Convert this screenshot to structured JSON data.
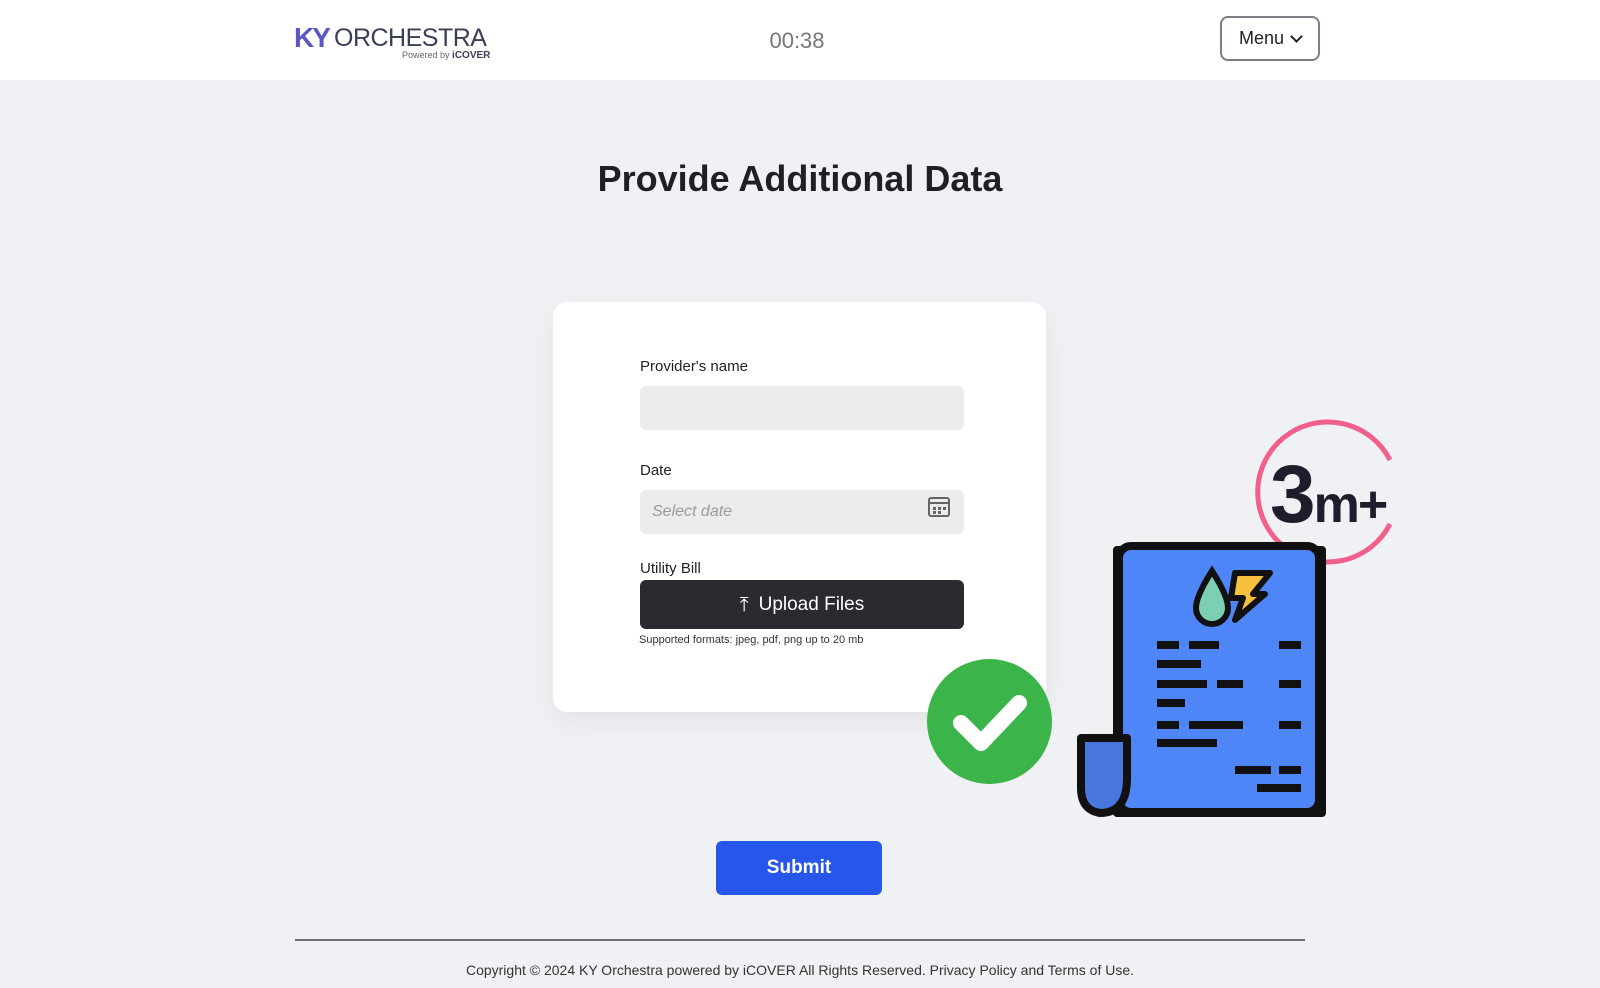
{
  "header": {
    "logo_ky": "KY",
    "logo_orchestra": "ORCHESTRA",
    "logo_powered": "Powered by",
    "logo_brand": "iCOVER",
    "timer": "00:38",
    "menu_label": "Menu"
  },
  "main": {
    "title": "Provide Additional Data",
    "form": {
      "provider_label": "Provider's name",
      "provider_value": "",
      "date_label": "Date",
      "date_placeholder": "Select date",
      "bill_label": "Utility Bill",
      "upload_label": "Upload Files",
      "upload_hint": "Supported formats: jpeg, pdf, png up to 20 mb"
    },
    "submit_label": "Submit"
  },
  "overlay": {
    "badge_number": "3",
    "badge_suffix": "m+",
    "check_color": "#3bb54a",
    "bill_color": "#4f86f7",
    "ring_color": "#f0608a"
  },
  "footer": {
    "copyright": "Copyright © 2024 KY Orchestra powered by iCOVER All Rights Reserved. Privacy Policy and Terms of Use."
  }
}
